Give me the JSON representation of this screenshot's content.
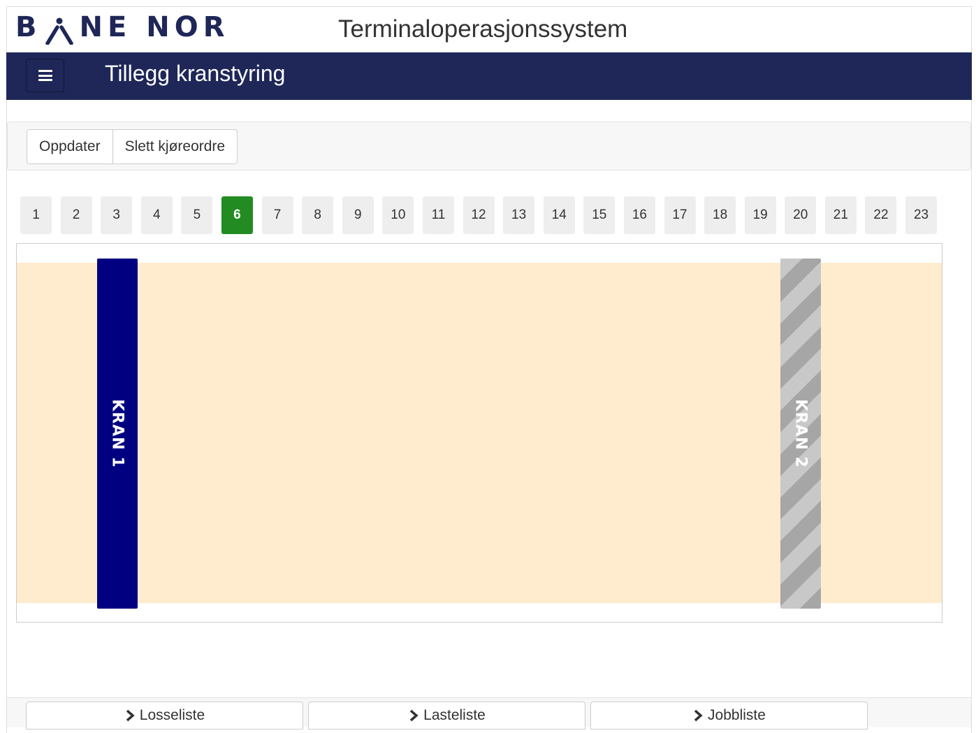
{
  "header": {
    "logo_text_left": "B",
    "logo_text_right": "NE NOR",
    "app_title": "Terminaloperasjonssystem"
  },
  "navbar": {
    "page_title": "Tillegg kranstyring"
  },
  "toolbar": {
    "refresh_label": "Oppdater",
    "delete_label": "Slett kjøreordre"
  },
  "tracks": {
    "selected": "6",
    "items": [
      "1",
      "2",
      "3",
      "4",
      "5",
      "6",
      "7",
      "8",
      "9",
      "10",
      "11",
      "12",
      "13",
      "14",
      "15",
      "16",
      "17",
      "18",
      "19",
      "20",
      "21",
      "22",
      "23"
    ]
  },
  "cranes": [
    {
      "label": "KRAN 1",
      "state": "active",
      "color": "#000080"
    },
    {
      "label": "KRAN 2",
      "state": "inactive",
      "color": "#b4b4b4"
    }
  ],
  "bottom_tabs": {
    "unload_label": "Losseliste",
    "load_label": "Lasteliste",
    "jobs_label": "Jobbliste"
  },
  "colors": {
    "brand": "#1e2757",
    "active_track": "#228b22",
    "crane_zone": "#ffebcd"
  }
}
